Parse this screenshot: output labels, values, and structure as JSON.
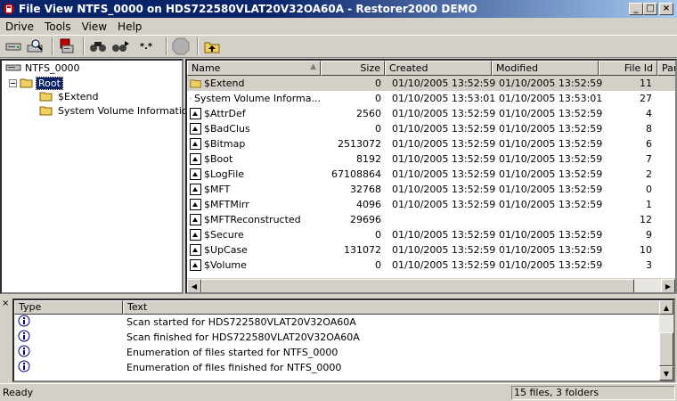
{
  "window": {
    "title": "File View NTFS_0000 on HDS722580VLAT20V32OA60A - Restorer2000 DEMO",
    "controls": [
      "_",
      "□",
      "×"
    ]
  },
  "menu": [
    "Drive",
    "Tools",
    "View",
    "Help"
  ],
  "toolbar": {
    "buttons": [
      "drive-icon",
      "search-drive-icon",
      "network-drive-icon",
      "find-icon",
      "find-next-icon",
      "mask-icon",
      "stop-icon",
      "up-folder-icon"
    ],
    "stop_label": "Stop",
    "mask_label": "*.*"
  },
  "tree": {
    "drive": "NTFS_0000",
    "root": "Root",
    "children": [
      "$Extend",
      "System Volume Information"
    ]
  },
  "list": {
    "columns": [
      "Name",
      "Size",
      "Created",
      "Modified",
      "File Id",
      "Par"
    ],
    "rows": [
      {
        "name": "$Extend",
        "size": "0",
        "created": "01/10/2005 13:52:59",
        "modified": "01/10/2005 13:52:59",
        "id": "11",
        "type": "folder"
      },
      {
        "name": "System Volume Informa...",
        "size": "0",
        "created": "01/10/2005 13:53:01",
        "modified": "01/10/2005 13:53:01",
        "id": "27",
        "type": "folder"
      },
      {
        "name": "$AttrDef",
        "size": "2560",
        "created": "01/10/2005 13:52:59",
        "modified": "01/10/2005 13:52:59",
        "id": "4",
        "type": "file"
      },
      {
        "name": "$BadClus",
        "size": "0",
        "created": "01/10/2005 13:52:59",
        "modified": "01/10/2005 13:52:59",
        "id": "8",
        "type": "file"
      },
      {
        "name": "$Bitmap",
        "size": "2513072",
        "created": "01/10/2005 13:52:59",
        "modified": "01/10/2005 13:52:59",
        "id": "6",
        "type": "file"
      },
      {
        "name": "$Boot",
        "size": "8192",
        "created": "01/10/2005 13:52:59",
        "modified": "01/10/2005 13:52:59",
        "id": "7",
        "type": "file"
      },
      {
        "name": "$LogFile",
        "size": "67108864",
        "created": "01/10/2005 13:52:59",
        "modified": "01/10/2005 13:52:59",
        "id": "2",
        "type": "file"
      },
      {
        "name": "$MFT",
        "size": "32768",
        "created": "01/10/2005 13:52:59",
        "modified": "01/10/2005 13:52:59",
        "id": "0",
        "type": "file"
      },
      {
        "name": "$MFTMirr",
        "size": "4096",
        "created": "01/10/2005 13:52:59",
        "modified": "01/10/2005 13:52:59",
        "id": "1",
        "type": "file"
      },
      {
        "name": "$MFTReconstructed",
        "size": "29696",
        "created": "",
        "modified": "",
        "id": "12",
        "type": "file"
      },
      {
        "name": "$Secure",
        "size": "0",
        "created": "01/10/2005 13:52:59",
        "modified": "01/10/2005 13:52:59",
        "id": "9",
        "type": "file"
      },
      {
        "name": "$UpCase",
        "size": "131072",
        "created": "01/10/2005 13:52:59",
        "modified": "01/10/2005 13:52:59",
        "id": "10",
        "type": "file"
      },
      {
        "name": "$Volume",
        "size": "0",
        "created": "01/10/2005 13:52:59",
        "modified": "01/10/2005 13:52:59",
        "id": "3",
        "type": "file"
      }
    ]
  },
  "log": {
    "close": "×",
    "columns": [
      "Type",
      "Text"
    ],
    "rows": [
      "Scan started for HDS722580VLAT20V32OA60A",
      "Scan finished for HDS722580VLAT20V32OA60A",
      "Enumeration of files started for NTFS_0000",
      "Enumeration of files finished for NTFS_0000"
    ]
  },
  "status": {
    "left": "Ready",
    "right": "15 files, 3 folders"
  },
  "colors": {
    "title_bar": "#0a246a",
    "selection": "#0a246a",
    "face": "#d4d0c8"
  }
}
